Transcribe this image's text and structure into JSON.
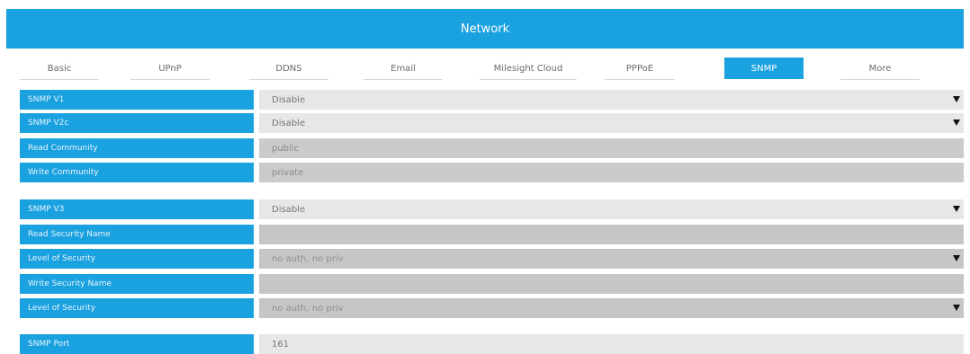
{
  "header": {
    "title": "Network"
  },
  "tabs": [
    "Basic",
    "UPnP",
    "DDNS",
    "Email",
    "Milesight Cloud",
    "PPPoE",
    "SNMP",
    "More"
  ],
  "active_tab": "SNMP",
  "colors": {
    "accent": "#1aa1e0"
  },
  "fields": {
    "snmp_v1": {
      "label": "SNMP V1",
      "value": "Disable"
    },
    "snmp_v2c": {
      "label": "SNMP V2c",
      "value": "Disable"
    },
    "read_community": {
      "label": "Read Community",
      "value": "public"
    },
    "write_community": {
      "label": "Write Community",
      "value": "private"
    },
    "snmp_v3": {
      "label": "SNMP V3",
      "value": "Disable"
    },
    "read_security_name": {
      "label": "Read Security Name",
      "value": ""
    },
    "read_level_of_security": {
      "label": "Level of Security",
      "value": "no auth, no priv"
    },
    "write_security_name": {
      "label": "Write Security Name",
      "value": ""
    },
    "write_level_of_security": {
      "label": "Level of Security",
      "value": "no auth, no priv"
    },
    "snmp_port": {
      "label": "SNMP Port",
      "value": "161"
    }
  },
  "icons": {
    "dropdown": "triangle-down-icon"
  }
}
